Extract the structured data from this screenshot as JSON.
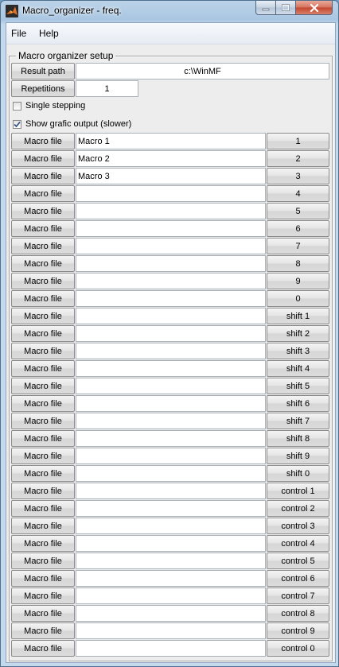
{
  "window": {
    "title": "Macro_organizer - freq.",
    "controls": [
      "minimize-icon",
      "maximize-icon",
      "close-icon"
    ]
  },
  "menu": [
    "File",
    "Help"
  ],
  "group": {
    "title": "Macro organizer setup"
  },
  "result_path": {
    "label": "Result path",
    "value": "c:\\WinMF"
  },
  "repetitions": {
    "label": "Repetitions",
    "value": "1"
  },
  "single_stepping": {
    "label": "Single stepping",
    "checked": false
  },
  "show_grafic": {
    "label": "Show grafic output (slower)",
    "checked": true
  },
  "macro_file_label": "Macro file",
  "rows": [
    {
      "value": "Macro 1",
      "key": "1"
    },
    {
      "value": "Macro 2",
      "key": "2"
    },
    {
      "value": "Macro 3",
      "key": "3"
    },
    {
      "value": "",
      "key": "4"
    },
    {
      "value": "",
      "key": "5"
    },
    {
      "value": "",
      "key": "6"
    },
    {
      "value": "",
      "key": "7"
    },
    {
      "value": "",
      "key": "8"
    },
    {
      "value": "",
      "key": "9"
    },
    {
      "value": "",
      "key": "0"
    },
    {
      "value": "",
      "key": "shift 1"
    },
    {
      "value": "",
      "key": "shift 2"
    },
    {
      "value": "",
      "key": "shift 3"
    },
    {
      "value": "",
      "key": "shift 4"
    },
    {
      "value": "",
      "key": "shift 5"
    },
    {
      "value": "",
      "key": "shift 6"
    },
    {
      "value": "",
      "key": "shift 7"
    },
    {
      "value": "",
      "key": "shift 8"
    },
    {
      "value": "",
      "key": "shift 9"
    },
    {
      "value": "",
      "key": "shift 0"
    },
    {
      "value": "",
      "key": "control 1"
    },
    {
      "value": "",
      "key": "control 2"
    },
    {
      "value": "",
      "key": "control 3"
    },
    {
      "value": "",
      "key": "control 4"
    },
    {
      "value": "",
      "key": "control 5"
    },
    {
      "value": "",
      "key": "control 6"
    },
    {
      "value": "",
      "key": "control 7"
    },
    {
      "value": "",
      "key": "control 8"
    },
    {
      "value": "",
      "key": "control 9"
    },
    {
      "value": "",
      "key": "control 0"
    }
  ]
}
